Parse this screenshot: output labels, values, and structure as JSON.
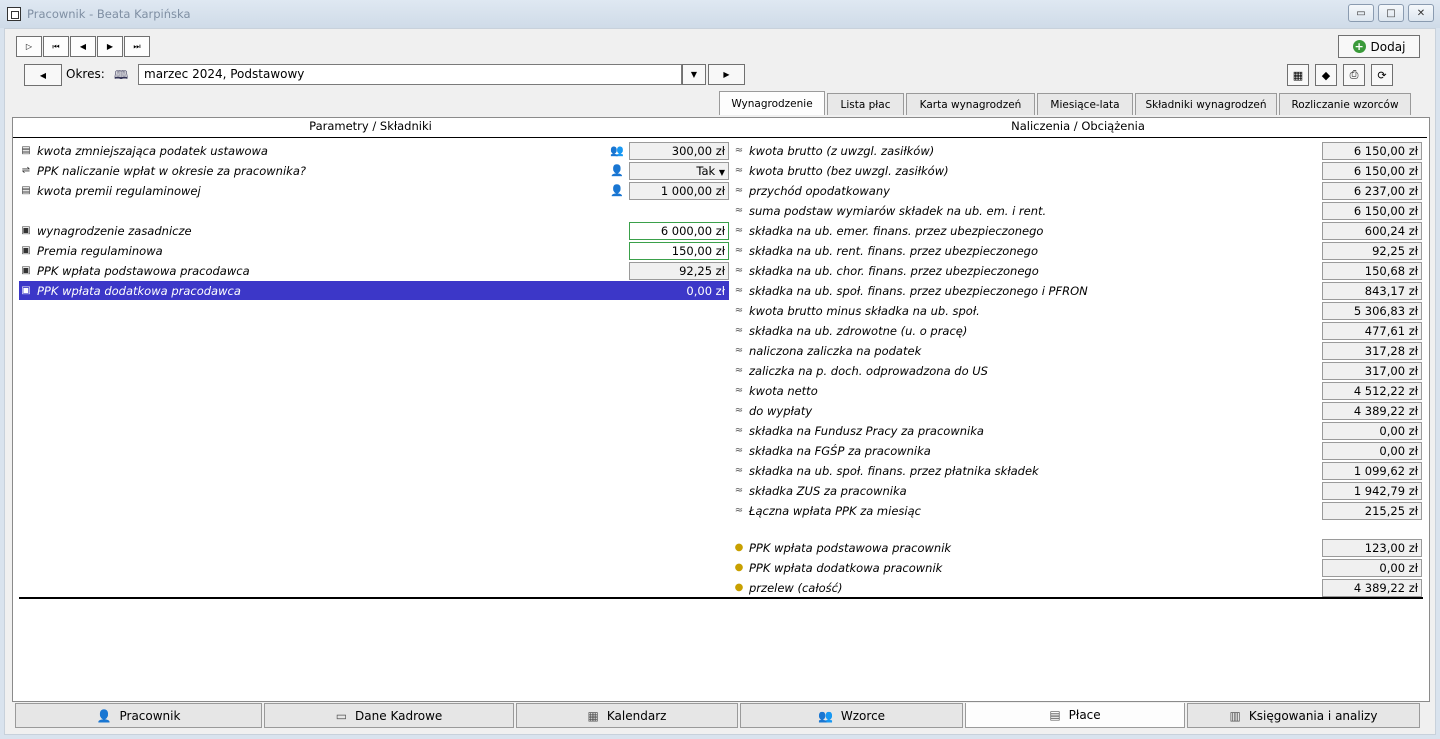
{
  "window": {
    "title": "Pracownik - Beata Karpińska"
  },
  "nav": {
    "first": "▷",
    "buttons": [
      "⏮",
      "◀",
      "▶",
      "⏭"
    ]
  },
  "add_button": {
    "label": "Dodaj"
  },
  "okres": {
    "label": "Okres:",
    "value": "marzec 2024, Podstawowy"
  },
  "tabs": [
    {
      "label": "Wynagrodzenie",
      "active": true
    },
    {
      "label": "Lista płac"
    },
    {
      "label": "Karta wynagrodzeń"
    },
    {
      "label": "Miesiące-lata"
    },
    {
      "label": "Składniki wynagrodzeń"
    },
    {
      "label": "Rozliczanie wzorców"
    }
  ],
  "left": {
    "header": "Parametry / Składniki",
    "rows": [
      {
        "label": "kwota zmniejszająca podatek ustawowa",
        "value": "300,00 zł"
      },
      {
        "label": "PPK naliczanie wpłat w okresie za pracownika?",
        "value": "Tak"
      },
      {
        "label": "kwota premii regulaminowej",
        "value": "1 000,00 zł"
      },
      {
        "label": "wynagrodzenie zasadnicze",
        "value": "6 000,00 zł"
      },
      {
        "label": "Premia regulaminowa",
        "value": "150,00 zł"
      },
      {
        "label": "PPK wpłata podstawowa pracodawca",
        "value": "92,25 zł"
      },
      {
        "label": "PPK wpłata dodatkowa pracodawca",
        "value": "0,00 zł"
      }
    ]
  },
  "right": {
    "header": "Naliczenia / Obciążenia",
    "rows": [
      {
        "label": "kwota brutto (z uwzgl. zasiłków)",
        "value": "6 150,00 zł"
      },
      {
        "label": "kwota brutto (bez uwzgl. zasiłków)",
        "value": "6 150,00 zł"
      },
      {
        "label": "przychód opodatkowany",
        "value": "6 237,00 zł"
      },
      {
        "label": "suma podstaw wymiarów składek na ub. em. i rent.",
        "value": "6 150,00 zł"
      },
      {
        "label": "składka na ub. emer. finans. przez ubezpieczonego",
        "value": "600,24 zł"
      },
      {
        "label": "składka na ub. rent. finans. przez ubezpieczonego",
        "value": "92,25 zł"
      },
      {
        "label": "składka na ub. chor. finans. przez ubezpieczonego",
        "value": "150,68 zł"
      },
      {
        "label": "składka na ub. społ. finans. przez ubezpieczonego i PFRON",
        "value": "843,17 zł"
      },
      {
        "label": "kwota brutto minus składka na ub. społ.",
        "value": "5 306,83 zł"
      },
      {
        "label": "składka na ub. zdrowotne (u. o pracę)",
        "value": "477,61 zł"
      },
      {
        "label": "naliczona zaliczka na podatek",
        "value": "317,28 zł"
      },
      {
        "label": "zaliczka na p. doch. odprowadzona do US",
        "value": "317,00 zł"
      },
      {
        "label": "kwota netto",
        "value": "4 512,22 zł"
      },
      {
        "label": "do wypłaty",
        "value": "4 389,22 zł"
      },
      {
        "label": "składka na Fundusz Pracy za pracownika",
        "value": "0,00 zł"
      },
      {
        "label": "składka na FGŚP za pracownika",
        "value": "0,00 zł"
      },
      {
        "label": "składka na ub. społ. finans. przez płatnika składek",
        "value": "1 099,62 zł"
      },
      {
        "label": "składka ZUS za pracownika",
        "value": "1 942,79 zł"
      },
      {
        "label": "Łączna wpłata PPK za miesiąc",
        "value": "215,25 zł"
      },
      {
        "label": "PPK wpłata podstawowa pracownik",
        "value": "123,00 zł"
      },
      {
        "label": "PPK wpłata dodatkowa pracownik",
        "value": "0,00 zł"
      },
      {
        "label": "przelew (całość)",
        "value": "4 389,22 zł"
      }
    ]
  },
  "bottom_tabs": [
    {
      "label": "Pracownik",
      "icon": "person-icon"
    },
    {
      "label": "Dane Kadrowe",
      "icon": "id-card-icon"
    },
    {
      "label": "Kalendarz",
      "icon": "calendar-icon"
    },
    {
      "label": "Wzorce",
      "icon": "people-icon"
    },
    {
      "label": "Płace",
      "icon": "calculator-icon",
      "active": true
    },
    {
      "label": "Księgowania i analizy",
      "icon": "ledger-icon"
    }
  ],
  "colors": {
    "selection": "#3c37c8",
    "highlight_border": "#3aa04a",
    "window_bg": "#f0f0f0"
  }
}
